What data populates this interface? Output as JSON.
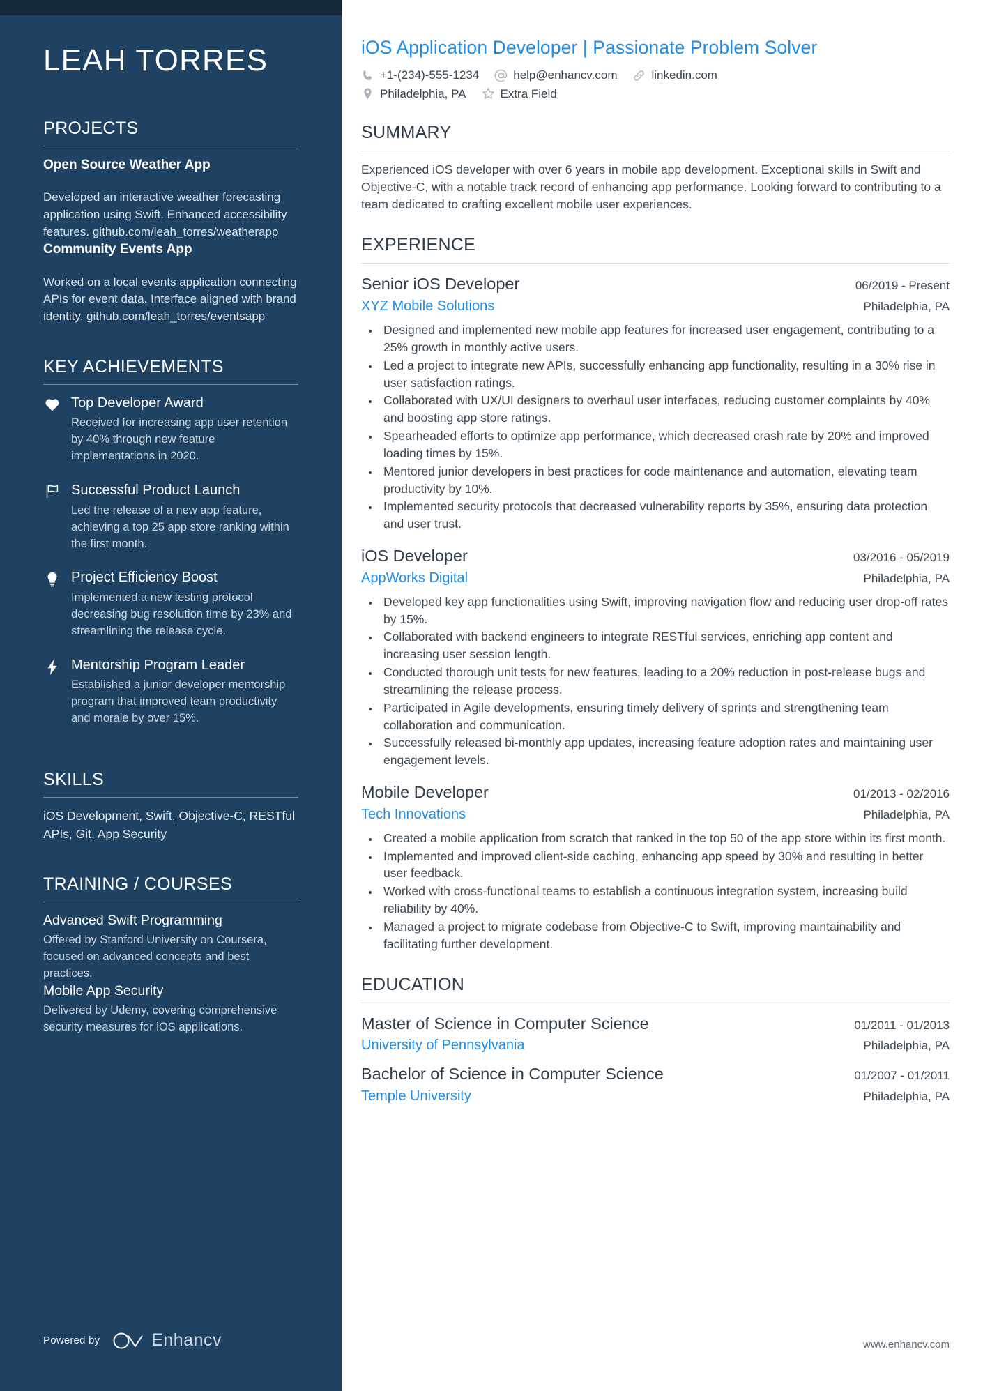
{
  "person": {
    "name": "LEAH TORRES",
    "headline": "iOS Application Developer | Passionate Problem Solver"
  },
  "contact": {
    "phone": "+1-(234)-555-1234",
    "email": "help@enhancv.com",
    "website": "linkedin.com",
    "location": "Philadelphia, PA",
    "extra": "Extra Field"
  },
  "sidebar": {
    "projects": {
      "title": "PROJECTS",
      "items": [
        {
          "name": "Open Source Weather App",
          "description": "Developed an interactive weather forecasting application using Swift. Enhanced accessibility features. github.com/leah_torres/weatherapp"
        },
        {
          "name": "Community Events App",
          "description": "Worked on a local events application connecting APIs for event data. Interface aligned with brand identity. github.com/leah_torres/eventsapp"
        }
      ]
    },
    "achievements": {
      "title": "KEY ACHIEVEMENTS",
      "items": [
        {
          "icon": "heart-icon",
          "title": "Top Developer Award",
          "description": "Received for increasing app user retention by 40% through new feature implementations in 2020."
        },
        {
          "icon": "flag-icon",
          "title": "Successful Product Launch",
          "description": "Led the release of a new app feature, achieving a top 25 app store ranking within the first month."
        },
        {
          "icon": "lightbulb-icon",
          "title": "Project Efficiency Boost",
          "description": "Implemented a new testing protocol decreasing bug resolution time by 23% and streamlining the release cycle."
        },
        {
          "icon": "bolt-icon",
          "title": "Mentorship Program Leader",
          "description": "Established a junior developer mentorship program that improved team productivity and morale by over 15%."
        }
      ]
    },
    "skills": {
      "title": "SKILLS",
      "text": "iOS Development, Swift, Objective-C, RESTful APIs, Git, App Security"
    },
    "training": {
      "title": "TRAINING / COURSES",
      "items": [
        {
          "name": "Advanced Swift Programming",
          "description": "Offered by Stanford University on Coursera, focused on advanced concepts and best practices."
        },
        {
          "name": "Mobile App Security",
          "description": "Delivered by Udemy, covering comprehensive security measures for iOS applications."
        }
      ]
    },
    "footer": {
      "powered_by": "Powered by",
      "brand": "Enhancv"
    }
  },
  "main": {
    "summary": {
      "title": "SUMMARY",
      "text": "Experienced iOS developer with over 6 years in mobile app development. Exceptional skills in Swift and Objective-C, with a notable track record of enhancing app performance. Looking forward to contributing to a team dedicated to crafting excellent mobile user experiences."
    },
    "experience": {
      "title": "EXPERIENCE",
      "items": [
        {
          "title": "Senior iOS Developer",
          "date": "06/2019 - Present",
          "company": "XYZ Mobile Solutions",
          "location": "Philadelphia, PA",
          "bullets": [
            "Designed and implemented new mobile app features for increased user engagement, contributing to a 25% growth in monthly active users.",
            "Led a project to integrate new APIs, successfully enhancing app functionality, resulting in a 30% rise in user satisfaction ratings.",
            "Collaborated with UX/UI designers to overhaul user interfaces, reducing customer complaints by 40% and boosting app store ratings.",
            "Spearheaded efforts to optimize app performance, which decreased crash rate by 20% and improved loading times by 15%.",
            "Mentored junior developers in best practices for code maintenance and automation, elevating team productivity by 10%.",
            "Implemented security protocols that decreased vulnerability reports by 35%, ensuring data protection and user trust."
          ]
        },
        {
          "title": "iOS Developer",
          "date": "03/2016 - 05/2019",
          "company": "AppWorks Digital",
          "location": "Philadelphia, PA",
          "bullets": [
            "Developed key app functionalities using Swift, improving navigation flow and reducing user drop-off rates by 15%.",
            "Collaborated with backend engineers to integrate RESTful services, enriching app content and increasing user session length.",
            "Conducted thorough unit tests for new features, leading to a 20% reduction in post-release bugs and streamlining the release process.",
            "Participated in Agile developments, ensuring timely delivery of sprints and strengthening team collaboration and communication.",
            "Successfully released bi-monthly app updates, increasing feature adoption rates and maintaining user engagement levels."
          ]
        },
        {
          "title": "Mobile Developer",
          "date": "01/2013 - 02/2016",
          "company": "Tech Innovations",
          "location": "Philadelphia, PA",
          "bullets": [
            "Created a mobile application from scratch that ranked in the top 50 of the app store within its first month.",
            "Implemented and improved client-side caching, enhancing app speed by 30% and resulting in better user feedback.",
            "Worked with cross-functional teams to establish a continuous integration system, increasing build reliability by 40%.",
            "Managed a project to migrate codebase from Objective-C to Swift, improving maintainability and facilitating further development."
          ]
        }
      ]
    },
    "education": {
      "title": "EDUCATION",
      "items": [
        {
          "degree": "Master of Science in Computer Science",
          "date": "01/2011 - 01/2013",
          "school": "University of Pennsylvania",
          "location": "Philadelphia, PA"
        },
        {
          "degree": "Bachelor of Science in Computer Science",
          "date": "01/2007 - 01/2011",
          "school": "Temple University",
          "location": "Philadelphia, PA"
        }
      ]
    },
    "footer": {
      "website": "www.enhancv.com"
    }
  },
  "colors": {
    "sidebar_bg": "#1f4263",
    "sidebar_topbar": "#16293c",
    "accent_blue": "#1f8ceb",
    "body_text": "#3c4852"
  }
}
